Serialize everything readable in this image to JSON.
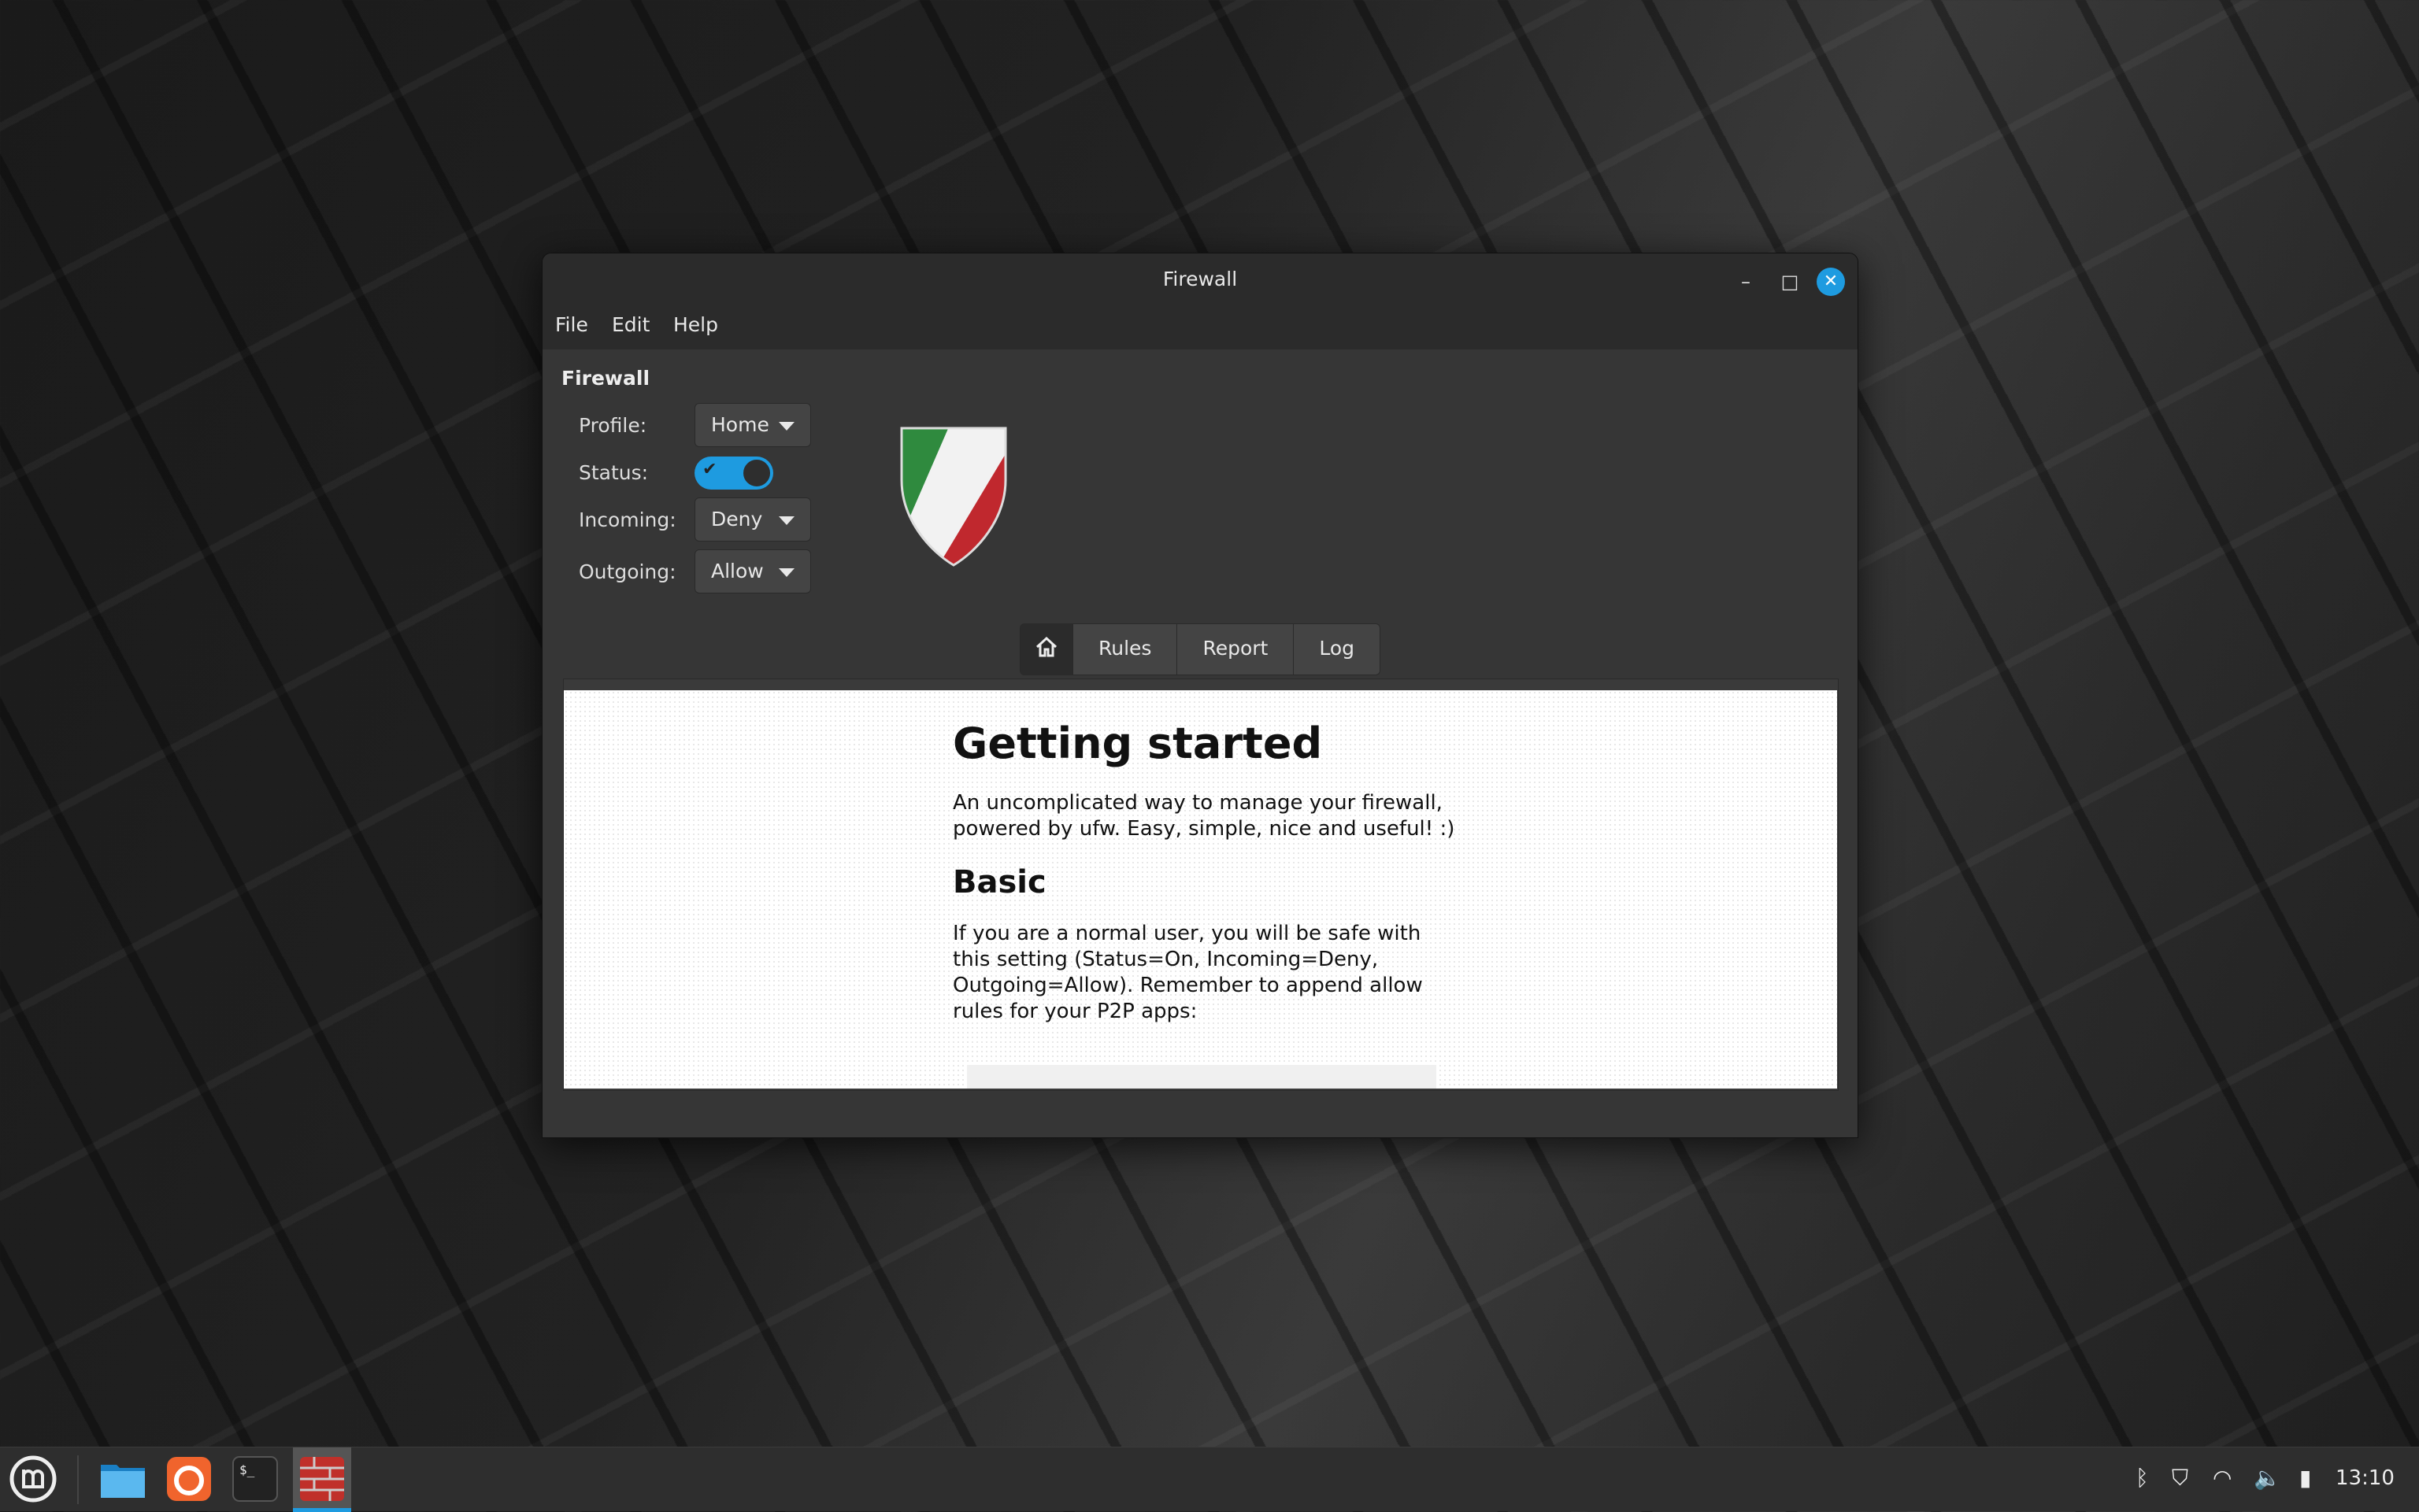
{
  "window": {
    "title": "Firewall",
    "minimize": "–",
    "maximize": "□",
    "close": "✕"
  },
  "menu": [
    "File",
    "Edit",
    "Help"
  ],
  "section_title": "Firewall",
  "controls": {
    "profile": {
      "label": "Profile:",
      "value": "Home"
    },
    "status": {
      "label": "Status:",
      "on": true
    },
    "incoming": {
      "label": "Incoming:",
      "value": "Deny"
    },
    "outgoing": {
      "label": "Outgoing:",
      "value": "Allow"
    }
  },
  "tabs": {
    "home_icon": "home-icon",
    "rules": "Rules",
    "report": "Report",
    "log": "Log"
  },
  "doc": {
    "h1": "Getting started",
    "p1": "An uncomplicated way to manage your firewall, powered by ufw. Easy, simple, nice and useful! :)",
    "h2": "Basic",
    "p2": "If you are a normal user, you will be safe with this setting (Status=On, Incoming=Deny, Outgoing=Allow). Remember to append allow rules for your P2P apps:"
  },
  "taskbar": {
    "apps": [
      "menu-icon",
      "files-icon",
      "firefox-icon",
      "terminal-icon",
      "firewall-icon"
    ],
    "tray": [
      "bluetooth-icon",
      "shield-icon",
      "wifi-icon",
      "volume-icon",
      "battery-icon"
    ],
    "clock": "13:10"
  },
  "colors": {
    "accent": "#1e9be0"
  }
}
